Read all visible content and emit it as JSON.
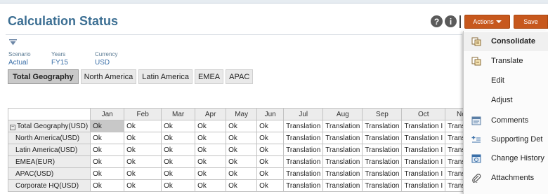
{
  "page": {
    "title": "Calculation Status"
  },
  "header": {
    "help_symbol": "?",
    "info_symbol": "i",
    "actions_label": "Actions",
    "save_label": "Save"
  },
  "pov": [
    {
      "label": "Scenario",
      "value": "Actual"
    },
    {
      "label": "Years",
      "value": "FY15"
    },
    {
      "label": "Currency",
      "value": "USD"
    }
  ],
  "tabs": [
    "Total Geography",
    "North America",
    "Latin America",
    "EMEA",
    "APAC"
  ],
  "grid": {
    "columns": [
      "Jan",
      "Feb",
      "Mar",
      "Apr",
      "May",
      "Jun",
      "Jul",
      "Aug",
      "Sep",
      "Oct",
      "Nov"
    ],
    "rows": [
      {
        "label": "Total Geography(USD)",
        "expand_symbol": "−",
        "cells": [
          "Ok",
          "Ok",
          "Ok",
          "Ok",
          "Ok",
          "Ok",
          "Translation",
          "Translation",
          "Translation",
          "Translation I",
          "Translatio"
        ]
      },
      {
        "label": "North America(USD)",
        "cells": [
          "Ok",
          "Ok",
          "Ok",
          "Ok",
          "Ok",
          "Ok",
          "Translation",
          "Translation",
          "Translation",
          "Translation I",
          "Translatio"
        ]
      },
      {
        "label": "Latin America(USD)",
        "cells": [
          "Ok",
          "Ok",
          "Ok",
          "Ok",
          "Ok",
          "Ok",
          "Translation",
          "Translation",
          "Translation",
          "Translation I",
          "Translatio"
        ]
      },
      {
        "label": "EMEA(EUR)",
        "cells": [
          "Ok",
          "Ok",
          "Ok",
          "Ok",
          "Ok",
          "Ok",
          "Translation",
          "Translation",
          "Translation",
          "Translation I",
          "Translatio"
        ]
      },
      {
        "label": "APAC(USD)",
        "cells": [
          "Ok",
          "Ok",
          "Ok",
          "Ok",
          "Ok",
          "Ok",
          "Translation",
          "Translation",
          "Translation",
          "Translation I",
          "Translatio"
        ]
      },
      {
        "label": "Corporate HQ(USD)",
        "cells": [
          "Ok",
          "Ok",
          "Ok",
          "Ok",
          "Ok",
          "Ok",
          "Translation",
          "Translation",
          "Translation",
          "Translation I",
          "Translatio"
        ]
      }
    ]
  },
  "actions_menu": {
    "items": [
      {
        "label": "Consolidate",
        "icon": "consolidate-icon"
      },
      {
        "label": "Translate",
        "icon": "translate-icon"
      },
      {
        "label": "Edit",
        "icon": ""
      },
      {
        "label": "Adjust",
        "icon": ""
      },
      {
        "label": "Comments",
        "icon": "comments-icon"
      },
      {
        "label": "Supporting Det",
        "icon": "supporting-detail-icon"
      },
      {
        "label": "Change History",
        "icon": "change-history-icon"
      },
      {
        "label": "Attachments",
        "icon": "attachments-icon"
      }
    ]
  },
  "colors": {
    "title": "#3c6f93",
    "accent_button": "#c7581d",
    "link": "#3a6fa8"
  }
}
